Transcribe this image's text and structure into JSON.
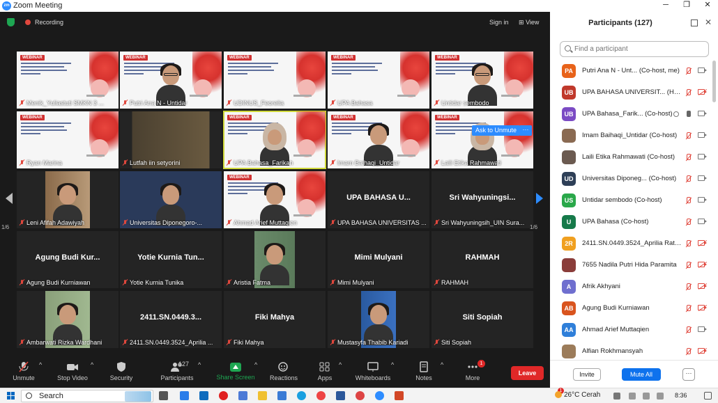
{
  "window": {
    "title": "Zoom Meeting",
    "logo_text": "zm",
    "minimize": "─",
    "maximize": "❐",
    "close": "✕"
  },
  "topbar": {
    "recording": "Recording",
    "signin": "Sign in",
    "view": "View",
    "view_icon": "⊞"
  },
  "gallery": {
    "page_left": "1/6",
    "page_right": "1/6",
    "ask_unmute": "Ask to Unmute",
    "more_options": "···",
    "tiles": [
      {
        "name": "Menik_Yuliastuti SMKN 3 ...",
        "type": "slide"
      },
      {
        "name": "Putri Ana N - Untidar",
        "type": "slide-person"
      },
      {
        "name": "UDINUS_Feorelia",
        "type": "slide"
      },
      {
        "name": "UPA Bahasa",
        "type": "slide"
      },
      {
        "name": "Untidar sembodo",
        "type": "slide-person"
      },
      {
        "name": "Ryan Marina",
        "type": "slide"
      },
      {
        "name": "Lutfah iin setyorini",
        "type": "photo"
      },
      {
        "name": "UPA Bahasa_Farikah",
        "type": "slide-person"
      },
      {
        "name": "Imam Baihaqi_Untidar",
        "type": "slide-person"
      },
      {
        "name": "Laili Etika Rahmawati",
        "type": "slide-person"
      },
      {
        "name": "Leni Afifah Adawiyah",
        "type": "photo"
      },
      {
        "name": "Universitas Diponegoro-...",
        "type": "photo"
      },
      {
        "name": "Ahmad Arief Muttaqien",
        "type": "slide-person"
      },
      {
        "name": "UPA BAHASA UNIVERSITAS ...",
        "type": "text",
        "big": "UPA BAHASA U..."
      },
      {
        "name": "Sri Wahyuningsih_UIN Sura...",
        "type": "text",
        "big": "Sri  Wahyuningsi..."
      },
      {
        "name": "Agung Budi Kurniawan",
        "type": "text",
        "big": "Agung Budi Kur..."
      },
      {
        "name": "Yotie Kurnia Tunika",
        "type": "text",
        "big": "Yotie Kurnia Tun..."
      },
      {
        "name": "Aristia Fatma",
        "type": "photo"
      },
      {
        "name": "Mimi Mulyani",
        "type": "text",
        "big": "Mimi Mulyani"
      },
      {
        "name": "RAHMAH",
        "type": "text",
        "big": "RAHMAH"
      },
      {
        "name": "Ambarwati Rizka Wardhani",
        "type": "photo"
      },
      {
        "name": "2411.SN.0449.3524_Aprilia ...",
        "type": "text",
        "big": "2411.SN.0449.3..."
      },
      {
        "name": "Fiki Mahya",
        "type": "text",
        "big": "Fiki Mahya"
      },
      {
        "name": "Mustasyfa Thabib Kariadi",
        "type": "photo"
      },
      {
        "name": "Siti Sopiah",
        "type": "text",
        "big": "Siti Sopiah"
      }
    ]
  },
  "slide": {
    "badge": "WEBINAR"
  },
  "toolbar": {
    "unmute": "Unmute",
    "stop_video": "Stop Video",
    "security": "Security",
    "participants": "Participants",
    "participants_count": "127",
    "share_screen": "Share Screen",
    "reactions": "Reactions",
    "apps": "Apps",
    "whiteboards": "Whiteboards",
    "notes": "Notes",
    "more": "More",
    "more_badge": "1",
    "leave": "Leave",
    "caret": "^"
  },
  "panel": {
    "title": "Participants (127)",
    "search_placeholder": "Find a participant",
    "invite": "Invite",
    "mute_all": "Mute All",
    "more": "···",
    "participants": [
      {
        "initials": "PA",
        "color": "#e8631a",
        "name": "Putri Ana N - Unt... (Co-host, me)",
        "mic": "off",
        "video": "on"
      },
      {
        "initials": "UB",
        "color": "#c0392b",
        "name": "UPA BAHASA UNIVERSIT... (Host)",
        "mic": "off",
        "video": "off"
      },
      {
        "initials": "UB",
        "color": "#7b4bc4",
        "name": "UPA Bahasa_Farik... (Co-host)",
        "mic": "on",
        "video": "on"
      },
      {
        "initials": "",
        "color": "#8a6a52",
        "name": "Imam Baihaqi_Untidar (Co-host)",
        "mic": "off",
        "video": "on"
      },
      {
        "initials": "",
        "color": "#6b5a50",
        "name": "Laili Etika Rahmawati (Co-host)",
        "mic": "off",
        "video": "on"
      },
      {
        "initials": "UD",
        "color": "#2e3f57",
        "name": "Universitas Diponeg... (Co-host)",
        "mic": "off",
        "video": "on"
      },
      {
        "initials": "US",
        "color": "#2aa84a",
        "name": "Untidar sembodo (Co-host)",
        "mic": "off",
        "video": "on"
      },
      {
        "initials": "U",
        "color": "#167a4a",
        "name": "UPA Bahasa (Co-host)",
        "mic": "off",
        "video": "on"
      },
      {
        "initials": "2R",
        "color": "#f0a020",
        "name": "2411.SN.0449.3524_Aprilia Ratn...",
        "mic": "off",
        "video": "off"
      },
      {
        "initials": "",
        "color": "#8a3d3a",
        "name": "7655 Nadila Putri Hida Paramita",
        "mic": "off",
        "video": "off"
      },
      {
        "initials": "A",
        "color": "#6f6fcf",
        "name": "Afrik Akhyani",
        "mic": "off",
        "video": "off"
      },
      {
        "initials": "AB",
        "color": "#d9541e",
        "name": "Agung Budi Kurniawan",
        "mic": "off",
        "video": "off"
      },
      {
        "initials": "AA",
        "color": "#2f7fd9",
        "name": "Ahmad Arief Muttaqien",
        "mic": "off",
        "video": "on"
      },
      {
        "initials": "",
        "color": "#9c7c5a",
        "name": "Alfian Rokhmansyah",
        "mic": "off",
        "video": "off"
      }
    ]
  },
  "taskbar": {
    "search": "Search",
    "weather": "26°C  Cerah",
    "time": "8:36",
    "weather_badge": "1"
  }
}
